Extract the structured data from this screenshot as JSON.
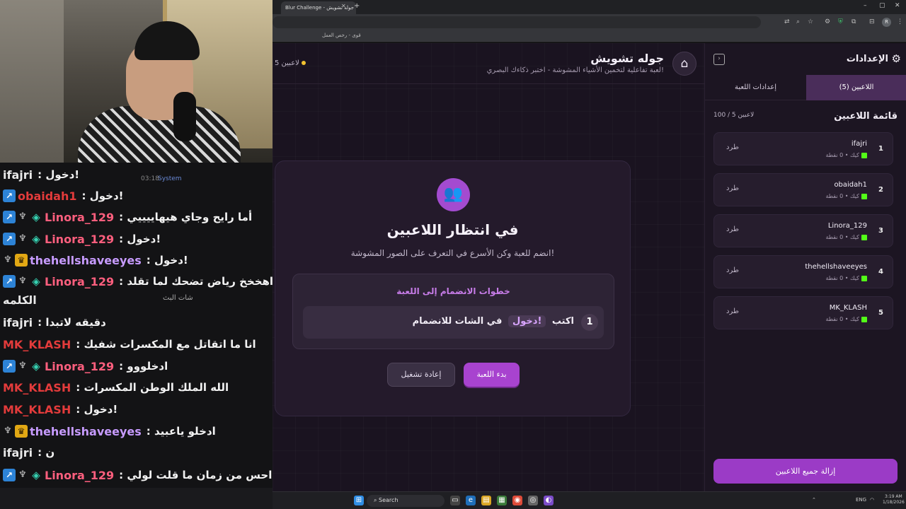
{
  "browser": {
    "tab_title": "Blur Challenge - جوله تشويش",
    "bookmark_label": "قوى - رخص العمل"
  },
  "chat": {
    "messages": [
      {
        "badges": [],
        "user": "ifajri",
        "user_color": "#e8e8e8",
        "text": ": دخول!"
      },
      {
        "badges": [
          "blue"
        ],
        "user": "obaidah1",
        "user_color": "#e33b3b",
        "text": ": دخول!"
      },
      {
        "badges": [
          "blue",
          "sword",
          "gem"
        ],
        "user": "Linora_129",
        "user_color": "#ff5f7e",
        "text": ": أما رايح وجاي هيهاييييي"
      },
      {
        "badges": [
          "blue",
          "sword",
          "gem"
        ],
        "user": "Linora_129",
        "user_color": "#ff5f7e",
        "text": ": دخول!"
      },
      {
        "badges": [
          "sword",
          "crown"
        ],
        "user": "thehellshaveeyes",
        "user_color": "#c79bff",
        "text": ": دخول!"
      },
      {
        "badges": [
          "blue",
          "sword",
          "gem"
        ],
        "user": "Linora_129",
        "user_color": "#ff5f7e",
        "text": ": اهخخخ رياض تضحك لما تقلد"
      },
      {
        "badges": [],
        "user": "الكلمه",
        "user_color": "#e8e8e8",
        "text": ""
      },
      {
        "badges": [],
        "user": "ifajri",
        "user_color": "#e8e8e8",
        "text": ": دقيقه لاتبدا"
      },
      {
        "badges": [],
        "user": "MK_KLASH",
        "user_color": "#e33b3b",
        "text": ": انا ما اتقاتل مع المكسرات شفيك"
      },
      {
        "badges": [
          "blue",
          "sword",
          "gem"
        ],
        "user": "Linora_129",
        "user_color": "#ff5f7e",
        "text": ": ادخلووو"
      },
      {
        "badges": [],
        "user": "MK_KLASH",
        "user_color": "#e33b3b",
        "text": ": الله الملك الوطن المكسرات"
      },
      {
        "badges": [],
        "user": "MK_KLASH",
        "user_color": "#e33b3b",
        "text": ": دخول!"
      },
      {
        "badges": [
          "sword",
          "crown"
        ],
        "user": "thehellshaveeyes",
        "user_color": "#c79bff",
        "text": ": ادخلو ياعبيد"
      },
      {
        "badges": [],
        "user": "ifajri",
        "user_color": "#e8e8e8",
        "text": ": ن"
      },
      {
        "badges": [
          "blue",
          "sword",
          "gem"
        ],
        "user": "Linora_129",
        "user_color": "#ff5f7e",
        "text": ": يمه احس من زمان ما قلت لولي"
      }
    ],
    "ghost_chat_label": "شات البث",
    "ghost_system": "System",
    "ghost_time": "03:18"
  },
  "header": {
    "title": "جوله تشويش",
    "subtitle": "لعبة تفاعلية لتخمين الأشياء المشوشة - اختبر ذكاءك البصري!",
    "player_count": "5 لاعبين"
  },
  "waiting_card": {
    "title": "في انتظار اللاعبين",
    "subtitle": "انضم للعبة وكن الأسرع في التعرف على الصور المشوشة!",
    "steps_title": "خطوات الانضمام إلى اللعبة",
    "step_number": "1",
    "step_before": "اكتب",
    "step_keyword": "!دخول",
    "step_after": "في الشات للانضمام",
    "start_label": "بدء اللعبة",
    "reset_label": "إعادة تشغيل"
  },
  "sidebar": {
    "title": "الإعدادات",
    "tab_players": "اللاعبين (5)",
    "tab_settings": "إعدادات اللعبة",
    "list_title": "قائمة اللاعبين",
    "count_label": "100 / 5 لاعبين",
    "kick_label": "طرد",
    "remove_all_label": "إزالة جميع اللاعبين",
    "players": [
      {
        "rank": "1",
        "name": "ifajri",
        "meta": "كيك • 0 نقطة"
      },
      {
        "rank": "2",
        "name": "obaidah1",
        "meta": "كيك • 0 نقطة"
      },
      {
        "rank": "3",
        "name": "Linora_129",
        "meta": "كيك • 0 نقطة"
      },
      {
        "rank": "4",
        "name": "thehellshaveeyes",
        "meta": "كيك • 0 نقطة"
      },
      {
        "rank": "5",
        "name": "MK_KLASH",
        "meta": "كيك • 0 نقطة"
      }
    ]
  },
  "taskbar": {
    "search_label": "Search",
    "lang": "ENG",
    "time": "3:19 AM",
    "date": "1/18/2026"
  },
  "colors": {
    "accent": "#a843cf",
    "background": "#1a1320",
    "kick_green": "#53fc18"
  }
}
